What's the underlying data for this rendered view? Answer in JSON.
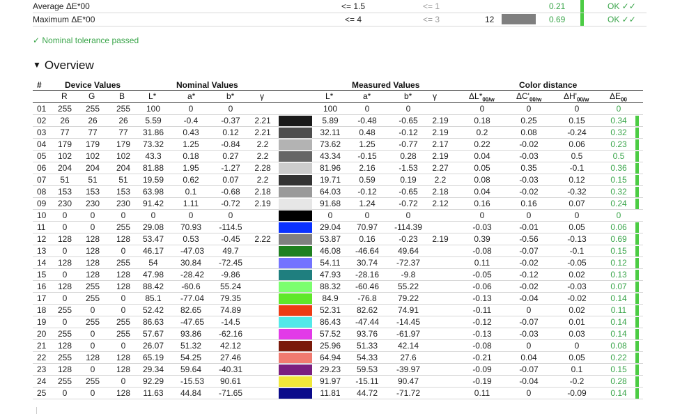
{
  "summary": [
    {
      "label": "Average ΔE*00",
      "nominal": "<= 1.5",
      "target": "<= 1",
      "count": "",
      "value": "0.21",
      "status": "OK ✓✓",
      "swatch": false
    },
    {
      "label": "Maximum ΔE*00",
      "nominal": "<= 4",
      "target": "<= 3",
      "count": "12",
      "value": "0.69",
      "status": "OK ✓✓",
      "swatch": true
    }
  ],
  "passed_text": "✓ Nominal tolerance passed",
  "overview_title": "Overview",
  "groups": {
    "hash": "#",
    "device": "Device Values",
    "nominal": "Nominal Values",
    "measured": "Measured Values",
    "distance": "Color distance"
  },
  "headers": {
    "r": "R",
    "g": "G",
    "b": "B",
    "l": "L*",
    "a": "a*",
    "bb": "b*",
    "gamma": "γ",
    "ml": "L*",
    "ma": "a*",
    "mb": "b*",
    "mgamma": "γ",
    "dl": "ΔL*",
    "dc": "ΔC'",
    "dh": "ΔH'",
    "sub": "00/w",
    "de": "ΔE",
    "desub": "00"
  },
  "rows": [
    {
      "id": "01",
      "r": "255",
      "g": "255",
      "b": "255",
      "l": "100",
      "a": "0",
      "bb": "0",
      "gm": "",
      "color": "#ffffff",
      "ml": "100",
      "ma": "0",
      "mb": "0",
      "mg": "",
      "dl": "0",
      "dc": "0",
      "dh": "0",
      "de": "0",
      "bar": false
    },
    {
      "id": "02",
      "r": "26",
      "g": "26",
      "b": "26",
      "l": "5.59",
      "a": "-0.4",
      "bb": "-0.37",
      "gm": "2.21",
      "color": "#1a1a1a",
      "ml": "5.89",
      "ma": "-0.48",
      "mb": "-0.65",
      "mg": "2.19",
      "dl": "0.18",
      "dc": "0.25",
      "dh": "0.15",
      "de": "0.34",
      "bar": true
    },
    {
      "id": "03",
      "r": "77",
      "g": "77",
      "b": "77",
      "l": "31.86",
      "a": "0.43",
      "bb": "0.12",
      "gm": "2.21",
      "color": "#4d4d4d",
      "ml": "32.11",
      "ma": "0.48",
      "mb": "-0.12",
      "mg": "2.19",
      "dl": "0.2",
      "dc": "0.08",
      "dh": "-0.24",
      "de": "0.32",
      "bar": true
    },
    {
      "id": "04",
      "r": "179",
      "g": "179",
      "b": "179",
      "l": "73.32",
      "a": "1.25",
      "bb": "-0.84",
      "gm": "2.2",
      "color": "#b3b3b3",
      "ml": "73.62",
      "ma": "1.25",
      "mb": "-0.77",
      "mg": "2.17",
      "dl": "0.22",
      "dc": "-0.02",
      "dh": "0.06",
      "de": "0.23",
      "bar": true
    },
    {
      "id": "05",
      "r": "102",
      "g": "102",
      "b": "102",
      "l": "43.3",
      "a": "0.18",
      "bb": "0.27",
      "gm": "2.2",
      "color": "#666666",
      "ml": "43.34",
      "ma": "-0.15",
      "mb": "0.28",
      "mg": "2.19",
      "dl": "0.04",
      "dc": "-0.03",
      "dh": "0.5",
      "de": "0.5",
      "bar": true
    },
    {
      "id": "06",
      "r": "204",
      "g": "204",
      "b": "204",
      "l": "81.88",
      "a": "1.95",
      "bb": "-1.27",
      "gm": "2.28",
      "color": "#cccccc",
      "ml": "81.96",
      "ma": "2.16",
      "mb": "-1.53",
      "mg": "2.27",
      "dl": "0.05",
      "dc": "0.35",
      "dh": "-0.1",
      "de": "0.36",
      "bar": true
    },
    {
      "id": "07",
      "r": "51",
      "g": "51",
      "b": "51",
      "l": "19.59",
      "a": "0.62",
      "bb": "0.07",
      "gm": "2.2",
      "color": "#333333",
      "ml": "19.71",
      "ma": "0.59",
      "mb": "0.19",
      "mg": "2.2",
      "dl": "0.08",
      "dc": "-0.03",
      "dh": "0.12",
      "de": "0.15",
      "bar": true
    },
    {
      "id": "08",
      "r": "153",
      "g": "153",
      "b": "153",
      "l": "63.98",
      "a": "0.1",
      "bb": "-0.68",
      "gm": "2.18",
      "color": "#999999",
      "ml": "64.03",
      "ma": "-0.12",
      "mb": "-0.65",
      "mg": "2.18",
      "dl": "0.04",
      "dc": "-0.02",
      "dh": "-0.32",
      "de": "0.32",
      "bar": true
    },
    {
      "id": "09",
      "r": "230",
      "g": "230",
      "b": "230",
      "l": "91.42",
      "a": "1.11",
      "bb": "-0.72",
      "gm": "2.19",
      "color": "#e6e6e6",
      "ml": "91.68",
      "ma": "1.24",
      "mb": "-0.72",
      "mg": "2.12",
      "dl": "0.16",
      "dc": "0.16",
      "dh": "0.07",
      "de": "0.24",
      "bar": true
    },
    {
      "id": "10",
      "r": "0",
      "g": "0",
      "b": "0",
      "l": "0",
      "a": "0",
      "bb": "0",
      "gm": "",
      "color": "#000000",
      "ml": "0",
      "ma": "0",
      "mb": "0",
      "mg": "",
      "dl": "0",
      "dc": "0",
      "dh": "0",
      "de": "0",
      "bar": false
    },
    {
      "id": "11",
      "r": "0",
      "g": "0",
      "b": "255",
      "l": "29.08",
      "a": "70.93",
      "bb": "-114.5",
      "gm": "",
      "color": "#0a32ff",
      "ml": "29.04",
      "ma": "70.97",
      "mb": "-114.39",
      "mg": "",
      "dl": "-0.03",
      "dc": "-0.01",
      "dh": "0.05",
      "de": "0.06",
      "bar": true
    },
    {
      "id": "12",
      "r": "128",
      "g": "128",
      "b": "128",
      "l": "53.47",
      "a": "0.53",
      "bb": "-0.45",
      "gm": "2.22",
      "color": "#808080",
      "ml": "53.87",
      "ma": "0.16",
      "mb": "-0.23",
      "mg": "2.19",
      "dl": "0.39",
      "dc": "-0.56",
      "dh": "-0.13",
      "de": "0.69",
      "bar": true
    },
    {
      "id": "13",
      "r": "0",
      "g": "128",
      "b": "0",
      "l": "46.17",
      "a": "-47.03",
      "bb": "49.7",
      "gm": "",
      "color": "#1f801f",
      "ml": "46.08",
      "ma": "-46.64",
      "mb": "49.64",
      "mg": "",
      "dl": "-0.08",
      "dc": "-0.07",
      "dh": "-0.1",
      "de": "0.15",
      "bar": true
    },
    {
      "id": "14",
      "r": "128",
      "g": "128",
      "b": "255",
      "l": "54",
      "a": "30.84",
      "bb": "-72.45",
      "gm": "",
      "color": "#7373ff",
      "ml": "54.11",
      "ma": "30.74",
      "mb": "-72.37",
      "mg": "",
      "dl": "0.11",
      "dc": "-0.02",
      "dh": "-0.05",
      "de": "0.12",
      "bar": true
    },
    {
      "id": "15",
      "r": "0",
      "g": "128",
      "b": "128",
      "l": "47.98",
      "a": "-28.42",
      "bb": "-9.86",
      "gm": "",
      "color": "#1f7f7f",
      "ml": "47.93",
      "ma": "-28.16",
      "mb": "-9.8",
      "mg": "",
      "dl": "-0.05",
      "dc": "-0.12",
      "dh": "0.02",
      "de": "0.13",
      "bar": true
    },
    {
      "id": "16",
      "r": "128",
      "g": "255",
      "b": "128",
      "l": "88.42",
      "a": "-60.6",
      "bb": "55.24",
      "gm": "",
      "color": "#7cff6f",
      "ml": "88.32",
      "ma": "-60.46",
      "mb": "55.22",
      "mg": "",
      "dl": "-0.06",
      "dc": "-0.02",
      "dh": "-0.03",
      "de": "0.07",
      "bar": true
    },
    {
      "id": "17",
      "r": "0",
      "g": "255",
      "b": "0",
      "l": "85.1",
      "a": "-77.04",
      "bb": "79.35",
      "gm": "",
      "color": "#5fe82a",
      "ml": "84.9",
      "ma": "-76.8",
      "mb": "79.22",
      "mg": "",
      "dl": "-0.13",
      "dc": "-0.04",
      "dh": "-0.02",
      "de": "0.14",
      "bar": true
    },
    {
      "id": "18",
      "r": "255",
      "g": "0",
      "b": "0",
      "l": "52.42",
      "a": "82.65",
      "bb": "74.89",
      "gm": "",
      "color": "#ee3b14",
      "ml": "52.31",
      "ma": "82.62",
      "mb": "74.91",
      "mg": "",
      "dl": "-0.11",
      "dc": "0",
      "dh": "0.02",
      "de": "0.11",
      "bar": true
    },
    {
      "id": "19",
      "r": "0",
      "g": "255",
      "b": "255",
      "l": "86.63",
      "a": "-47.65",
      "bb": "-14.5",
      "gm": "",
      "color": "#52e9e9",
      "ml": "86.43",
      "ma": "-47.44",
      "mb": "-14.45",
      "mg": "",
      "dl": "-0.12",
      "dc": "-0.07",
      "dh": "0.01",
      "de": "0.14",
      "bar": true
    },
    {
      "id": "20",
      "r": "255",
      "g": "0",
      "b": "255",
      "l": "57.67",
      "a": "93.86",
      "bb": "-62.16",
      "gm": "",
      "color": "#e23ae8",
      "ml": "57.52",
      "ma": "93.76",
      "mb": "-61.97",
      "mg": "",
      "dl": "-0.13",
      "dc": "-0.03",
      "dh": "0.03",
      "de": "0.14",
      "bar": true
    },
    {
      "id": "21",
      "r": "128",
      "g": "0",
      "b": "0",
      "l": "26.07",
      "a": "51.32",
      "bb": "42.12",
      "gm": "",
      "color": "#7a1a0a",
      "ml": "25.96",
      "ma": "51.33",
      "mb": "42.14",
      "mg": "",
      "dl": "-0.08",
      "dc": "0",
      "dh": "0",
      "de": "0.08",
      "bar": true
    },
    {
      "id": "22",
      "r": "255",
      "g": "128",
      "b": "128",
      "l": "65.19",
      "a": "54.25",
      "bb": "27.46",
      "gm": "",
      "color": "#f07a70",
      "ml": "64.94",
      "ma": "54.33",
      "mb": "27.6",
      "mg": "",
      "dl": "-0.21",
      "dc": "0.04",
      "dh": "0.05",
      "de": "0.22",
      "bar": true
    },
    {
      "id": "23",
      "r": "128",
      "g": "0",
      "b": "128",
      "l": "29.34",
      "a": "59.64",
      "bb": "-40.31",
      "gm": "",
      "color": "#7a1f80",
      "ml": "29.23",
      "ma": "59.53",
      "mb": "-39.97",
      "mg": "",
      "dl": "-0.09",
      "dc": "-0.07",
      "dh": "0.1",
      "de": "0.15",
      "bar": true
    },
    {
      "id": "24",
      "r": "255",
      "g": "255",
      "b": "0",
      "l": "92.29",
      "a": "-15.53",
      "bb": "90.61",
      "gm": "",
      "color": "#f0e83a",
      "ml": "91.97",
      "ma": "-15.11",
      "mb": "90.47",
      "mg": "",
      "dl": "-0.19",
      "dc": "-0.04",
      "dh": "-0.2",
      "de": "0.28",
      "bar": true
    },
    {
      "id": "25",
      "r": "0",
      "g": "0",
      "b": "128",
      "l": "11.63",
      "a": "44.84",
      "bb": "-71.65",
      "gm": "",
      "color": "#0a0a8a",
      "ml": "11.81",
      "ma": "44.72",
      "mb": "-71.72",
      "mg": "",
      "dl": "0.11",
      "dc": "0",
      "dh": "-0.09",
      "de": "0.14",
      "bar": true
    }
  ]
}
